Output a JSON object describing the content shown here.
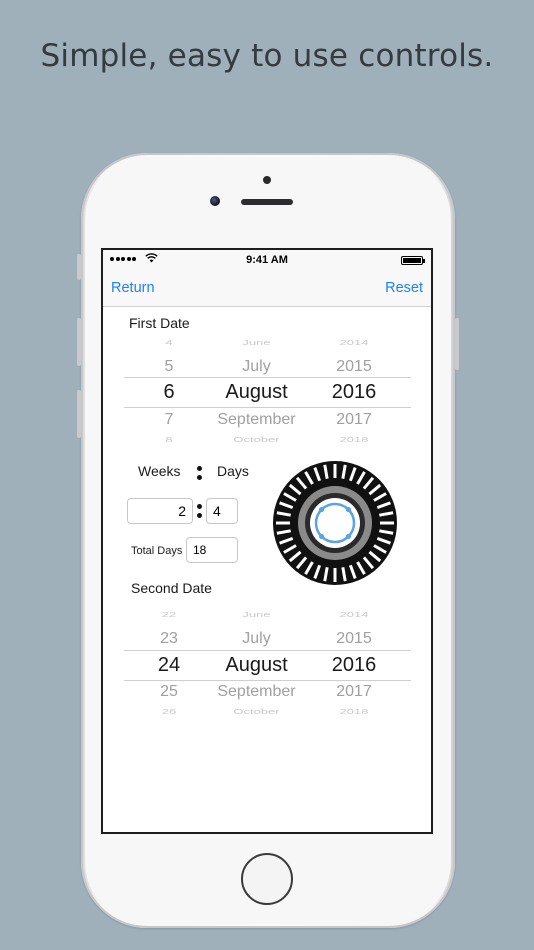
{
  "headline": "Simple, easy to use controls.",
  "status_bar": {
    "time": "9:41 AM"
  },
  "nav": {
    "left_label": "Return",
    "right_label": "Reset"
  },
  "first_date": {
    "label": "First Date",
    "days": [
      "4",
      "5",
      "6",
      "7",
      "8"
    ],
    "months": [
      "June",
      "July",
      "August",
      "September",
      "October"
    ],
    "years": [
      "2014",
      "2015",
      "2016",
      "2017",
      "2018"
    ],
    "selected": {
      "day": "6",
      "month": "August",
      "year": "2016"
    }
  },
  "duration": {
    "weeks_label": "Weeks",
    "days_label": "Days",
    "weeks_value": "2",
    "days_value": "4",
    "total_days_label": "Total Days",
    "total_days_value": "18"
  },
  "second_date": {
    "label": "Second Date",
    "days": [
      "22",
      "23",
      "24",
      "25",
      "26"
    ],
    "months": [
      "June",
      "July",
      "August",
      "September",
      "October"
    ],
    "years": [
      "2014",
      "2015",
      "2016",
      "2017",
      "2018"
    ],
    "selected": {
      "day": "24",
      "month": "August",
      "year": "2016"
    }
  },
  "colors": {
    "accent": "#1a82fb",
    "background": "#9fb0ba",
    "wheel_ring": "#111111",
    "wheel_handle": "#5aa3e6"
  },
  "icons": [
    "wifi-icon",
    "battery-icon",
    "signal-dots-icon",
    "colon-separator-icon",
    "jog-wheel-icon"
  ]
}
